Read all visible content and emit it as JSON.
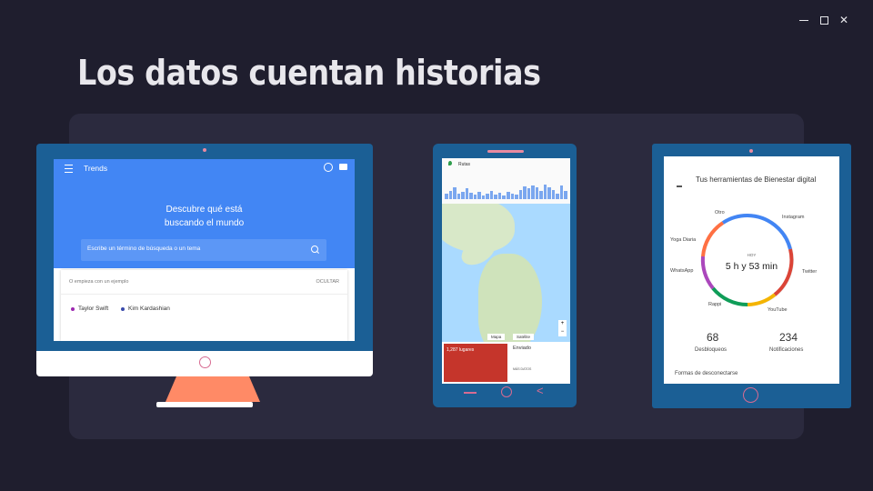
{
  "window_controls": {
    "minimize": "—",
    "maximize": "□",
    "close": "✕"
  },
  "slide": {
    "title": "Los datos cuentan historias"
  },
  "monitor": {
    "app_title": "Trends",
    "headline_line1": "Descubre qué está",
    "headline_line2": "buscando el mundo",
    "search_placeholder": "Escribe un término de búsqueda o un tema",
    "examples_label": "O empieza con un ejemplo",
    "hide_label": "OCULTAR",
    "examples": [
      {
        "label": "Taylor Swift",
        "color": "#9c27b0"
      },
      {
        "label": "Kim Kardashian",
        "color": "#3949ab"
      }
    ]
  },
  "phone": {
    "maps_title": "Rutas",
    "map_tab": "Mapa",
    "satellite_tab": "Satélite",
    "card_title": "1,287 lugares",
    "env_title": "Enviado",
    "more_label": "MÁS DATOS"
  },
  "tablet": {
    "title": "Tus herramientas de Bienestar digital",
    "today_label": "HOY",
    "time": "5 h y 53 min",
    "ring_labels": {
      "otro": "Otro",
      "instagram": "Instagram",
      "yoga": "Yoga Diaria",
      "whatsapp": "WhatsApp",
      "twitter": "Twitter",
      "rappi": "Rappi",
      "youtube": "YouTube"
    },
    "unlocks_value": "68",
    "unlocks_label": "Desbloqueos",
    "notifications_value": "234",
    "notifications_label": "Notificaciones",
    "disconnect_label": "Formas de desconectarse"
  },
  "colors": {
    "background": "#1f1e2e",
    "panel": "#2b2a3e",
    "device_frame": "#1b5f95",
    "accent_pink": "#d76b92",
    "trends_blue": "#4286f4"
  }
}
